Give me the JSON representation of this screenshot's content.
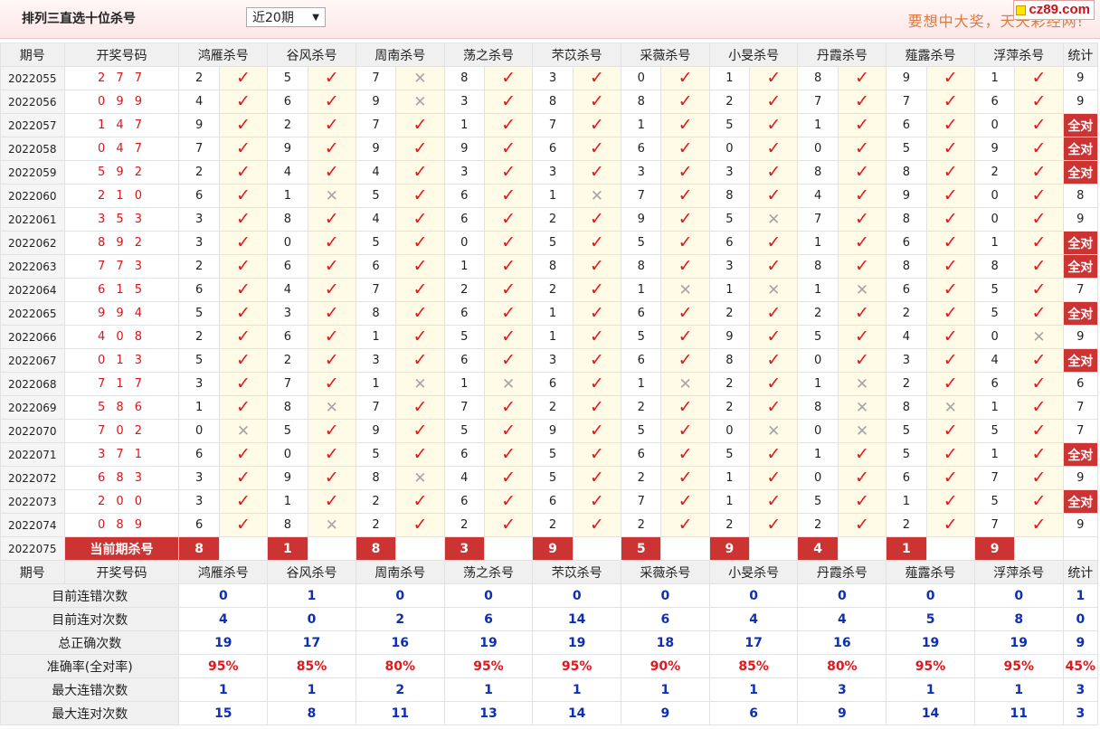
{
  "header": {
    "title": "排列三直选十位杀号",
    "period_select": "近20期",
    "slogan": "要想中大奖，天天彩经网!",
    "logo": "cz89.com"
  },
  "columns": {
    "issue": "期号",
    "draw": "开奖号码",
    "experts": [
      "鸿雁杀号",
      "谷风杀号",
      "周南杀号",
      "荡之杀号",
      "芣苡杀号",
      "采薇杀号",
      "小旻杀号",
      "丹霞杀号",
      "薤露杀号",
      "浮萍杀号"
    ],
    "stat": "统计"
  },
  "marks": {
    "ok": "✓",
    "bad": "✕"
  },
  "rows": [
    {
      "issue": "2022055",
      "draw": "2 7 7",
      "kills": [
        [
          "2",
          1
        ],
        [
          "5",
          1
        ],
        [
          "7",
          0
        ],
        [
          "8",
          1
        ],
        [
          "3",
          1
        ],
        [
          "0",
          1
        ],
        [
          "1",
          1
        ],
        [
          "8",
          1
        ],
        [
          "9",
          1
        ],
        [
          "1",
          1
        ]
      ],
      "stat": "9"
    },
    {
      "issue": "2022056",
      "draw": "0 9 9",
      "kills": [
        [
          "4",
          1
        ],
        [
          "6",
          1
        ],
        [
          "9",
          0
        ],
        [
          "3",
          1
        ],
        [
          "8",
          1
        ],
        [
          "8",
          1
        ],
        [
          "2",
          1
        ],
        [
          "7",
          1
        ],
        [
          "7",
          1
        ],
        [
          "6",
          1
        ]
      ],
      "stat": "9"
    },
    {
      "issue": "2022057",
      "draw": "1 4 7",
      "kills": [
        [
          "9",
          1
        ],
        [
          "2",
          1
        ],
        [
          "7",
          1
        ],
        [
          "1",
          1
        ],
        [
          "7",
          1
        ],
        [
          "1",
          1
        ],
        [
          "5",
          1
        ],
        [
          "1",
          1
        ],
        [
          "6",
          1
        ],
        [
          "0",
          1
        ]
      ],
      "stat": "全对"
    },
    {
      "issue": "2022058",
      "draw": "0 4 7",
      "kills": [
        [
          "7",
          1
        ],
        [
          "9",
          1
        ],
        [
          "9",
          1
        ],
        [
          "9",
          1
        ],
        [
          "6",
          1
        ],
        [
          "6",
          1
        ],
        [
          "0",
          1
        ],
        [
          "0",
          1
        ],
        [
          "5",
          1
        ],
        [
          "9",
          1
        ]
      ],
      "stat": "全对"
    },
    {
      "issue": "2022059",
      "draw": "5 9 2",
      "kills": [
        [
          "2",
          1
        ],
        [
          "4",
          1
        ],
        [
          "4",
          1
        ],
        [
          "3",
          1
        ],
        [
          "3",
          1
        ],
        [
          "3",
          1
        ],
        [
          "3",
          1
        ],
        [
          "8",
          1
        ],
        [
          "8",
          1
        ],
        [
          "2",
          1
        ]
      ],
      "stat": "全对"
    },
    {
      "issue": "2022060",
      "draw": "2 1 0",
      "kills": [
        [
          "6",
          1
        ],
        [
          "1",
          0
        ],
        [
          "5",
          1
        ],
        [
          "6",
          1
        ],
        [
          "1",
          0
        ],
        [
          "7",
          1
        ],
        [
          "8",
          1
        ],
        [
          "4",
          1
        ],
        [
          "9",
          1
        ],
        [
          "0",
          1
        ]
      ],
      "stat": "8"
    },
    {
      "issue": "2022061",
      "draw": "3 5 3",
      "kills": [
        [
          "3",
          1
        ],
        [
          "8",
          1
        ],
        [
          "4",
          1
        ],
        [
          "6",
          1
        ],
        [
          "2",
          1
        ],
        [
          "9",
          1
        ],
        [
          "5",
          0
        ],
        [
          "7",
          1
        ],
        [
          "8",
          1
        ],
        [
          "0",
          1
        ]
      ],
      "stat": "9"
    },
    {
      "issue": "2022062",
      "draw": "8 9 2",
      "kills": [
        [
          "3",
          1
        ],
        [
          "0",
          1
        ],
        [
          "5",
          1
        ],
        [
          "0",
          1
        ],
        [
          "5",
          1
        ],
        [
          "5",
          1
        ],
        [
          "6",
          1
        ],
        [
          "1",
          1
        ],
        [
          "6",
          1
        ],
        [
          "1",
          1
        ]
      ],
      "stat": "全对"
    },
    {
      "issue": "2022063",
      "draw": "7 7 3",
      "kills": [
        [
          "2",
          1
        ],
        [
          "6",
          1
        ],
        [
          "6",
          1
        ],
        [
          "1",
          1
        ],
        [
          "8",
          1
        ],
        [
          "8",
          1
        ],
        [
          "3",
          1
        ],
        [
          "8",
          1
        ],
        [
          "8",
          1
        ],
        [
          "8",
          1
        ]
      ],
      "stat": "全对"
    },
    {
      "issue": "2022064",
      "draw": "6 1 5",
      "kills": [
        [
          "6",
          1
        ],
        [
          "4",
          1
        ],
        [
          "7",
          1
        ],
        [
          "2",
          1
        ],
        [
          "2",
          1
        ],
        [
          "1",
          0
        ],
        [
          "1",
          0
        ],
        [
          "1",
          0
        ],
        [
          "6",
          1
        ],
        [
          "5",
          1
        ]
      ],
      "stat": "7"
    },
    {
      "issue": "2022065",
      "draw": "9 9 4",
      "kills": [
        [
          "5",
          1
        ],
        [
          "3",
          1
        ],
        [
          "8",
          1
        ],
        [
          "6",
          1
        ],
        [
          "1",
          1
        ],
        [
          "6",
          1
        ],
        [
          "2",
          1
        ],
        [
          "2",
          1
        ],
        [
          "2",
          1
        ],
        [
          "5",
          1
        ]
      ],
      "stat": "全对"
    },
    {
      "issue": "2022066",
      "draw": "4 0 8",
      "kills": [
        [
          "2",
          1
        ],
        [
          "6",
          1
        ],
        [
          "1",
          1
        ],
        [
          "5",
          1
        ],
        [
          "1",
          1
        ],
        [
          "5",
          1
        ],
        [
          "9",
          1
        ],
        [
          "5",
          1
        ],
        [
          "4",
          1
        ],
        [
          "0",
          0
        ]
      ],
      "stat": "9"
    },
    {
      "issue": "2022067",
      "draw": "0 1 3",
      "kills": [
        [
          "5",
          1
        ],
        [
          "2",
          1
        ],
        [
          "3",
          1
        ],
        [
          "6",
          1
        ],
        [
          "3",
          1
        ],
        [
          "6",
          1
        ],
        [
          "8",
          1
        ],
        [
          "0",
          1
        ],
        [
          "3",
          1
        ],
        [
          "4",
          1
        ]
      ],
      "stat": "全对"
    },
    {
      "issue": "2022068",
      "draw": "7 1 7",
      "kills": [
        [
          "3",
          1
        ],
        [
          "7",
          1
        ],
        [
          "1",
          0
        ],
        [
          "1",
          0
        ],
        [
          "6",
          1
        ],
        [
          "1",
          0
        ],
        [
          "2",
          1
        ],
        [
          "1",
          0
        ],
        [
          "2",
          1
        ],
        [
          "6",
          1
        ]
      ],
      "stat": "6"
    },
    {
      "issue": "2022069",
      "draw": "5 8 6",
      "kills": [
        [
          "1",
          1
        ],
        [
          "8",
          0
        ],
        [
          "7",
          1
        ],
        [
          "7",
          1
        ],
        [
          "2",
          1
        ],
        [
          "2",
          1
        ],
        [
          "2",
          1
        ],
        [
          "8",
          0
        ],
        [
          "8",
          0
        ],
        [
          "1",
          1
        ]
      ],
      "stat": "7"
    },
    {
      "issue": "2022070",
      "draw": "7 0 2",
      "kills": [
        [
          "0",
          0
        ],
        [
          "5",
          1
        ],
        [
          "9",
          1
        ],
        [
          "5",
          1
        ],
        [
          "9",
          1
        ],
        [
          "5",
          1
        ],
        [
          "0",
          0
        ],
        [
          "0",
          0
        ],
        [
          "5",
          1
        ],
        [
          "5",
          1
        ]
      ],
      "stat": "7"
    },
    {
      "issue": "2022071",
      "draw": "3 7 1",
      "kills": [
        [
          "6",
          1
        ],
        [
          "0",
          1
        ],
        [
          "5",
          1
        ],
        [
          "6",
          1
        ],
        [
          "5",
          1
        ],
        [
          "6",
          1
        ],
        [
          "5",
          1
        ],
        [
          "1",
          1
        ],
        [
          "5",
          1
        ],
        [
          "1",
          1
        ]
      ],
      "stat": "全对"
    },
    {
      "issue": "2022072",
      "draw": "6 8 3",
      "kills": [
        [
          "3",
          1
        ],
        [
          "9",
          1
        ],
        [
          "8",
          0
        ],
        [
          "4",
          1
        ],
        [
          "5",
          1
        ],
        [
          "2",
          1
        ],
        [
          "1",
          1
        ],
        [
          "0",
          1
        ],
        [
          "6",
          1
        ],
        [
          "7",
          1
        ]
      ],
      "stat": "9"
    },
    {
      "issue": "2022073",
      "draw": "2 0 0",
      "kills": [
        [
          "3",
          1
        ],
        [
          "1",
          1
        ],
        [
          "2",
          1
        ],
        [
          "6",
          1
        ],
        [
          "6",
          1
        ],
        [
          "7",
          1
        ],
        [
          "1",
          1
        ],
        [
          "5",
          1
        ],
        [
          "1",
          1
        ],
        [
          "5",
          1
        ]
      ],
      "stat": "全对"
    },
    {
      "issue": "2022074",
      "draw": "0 8 9",
      "kills": [
        [
          "6",
          1
        ],
        [
          "8",
          0
        ],
        [
          "2",
          1
        ],
        [
          "2",
          1
        ],
        [
          "2",
          1
        ],
        [
          "2",
          1
        ],
        [
          "2",
          1
        ],
        [
          "2",
          1
        ],
        [
          "2",
          1
        ],
        [
          "7",
          1
        ]
      ],
      "stat": "9"
    }
  ],
  "current": {
    "issue": "2022075",
    "label": "当前期杀号",
    "kills": [
      "8",
      "1",
      "8",
      "3",
      "9",
      "5",
      "9",
      "4",
      "1",
      "9"
    ]
  },
  "summary": [
    {
      "label": "目前连错次数",
      "values": [
        "0",
        "1",
        "0",
        "0",
        "0",
        "0",
        "0",
        "0",
        "0",
        "0"
      ],
      "stat": "1",
      "pct": false
    },
    {
      "label": "目前连对次数",
      "values": [
        "4",
        "0",
        "2",
        "6",
        "14",
        "6",
        "4",
        "4",
        "5",
        "8"
      ],
      "stat": "0",
      "pct": false
    },
    {
      "label": "总正确次数",
      "values": [
        "19",
        "17",
        "16",
        "19",
        "19",
        "18",
        "17",
        "16",
        "19",
        "19"
      ],
      "stat": "9",
      "pct": false
    },
    {
      "label": "准确率(全对率)",
      "values": [
        "95%",
        "85%",
        "80%",
        "95%",
        "95%",
        "90%",
        "85%",
        "80%",
        "95%",
        "95%"
      ],
      "stat": "45%",
      "pct": true
    },
    {
      "label": "最大连错次数",
      "values": [
        "1",
        "1",
        "2",
        "1",
        "1",
        "1",
        "1",
        "3",
        "1",
        "1"
      ],
      "stat": "3",
      "pct": false
    },
    {
      "label": "最大连对次数",
      "values": [
        "15",
        "8",
        "11",
        "13",
        "14",
        "9",
        "6",
        "9",
        "14",
        "11"
      ],
      "stat": "3",
      "pct": false
    }
  ]
}
